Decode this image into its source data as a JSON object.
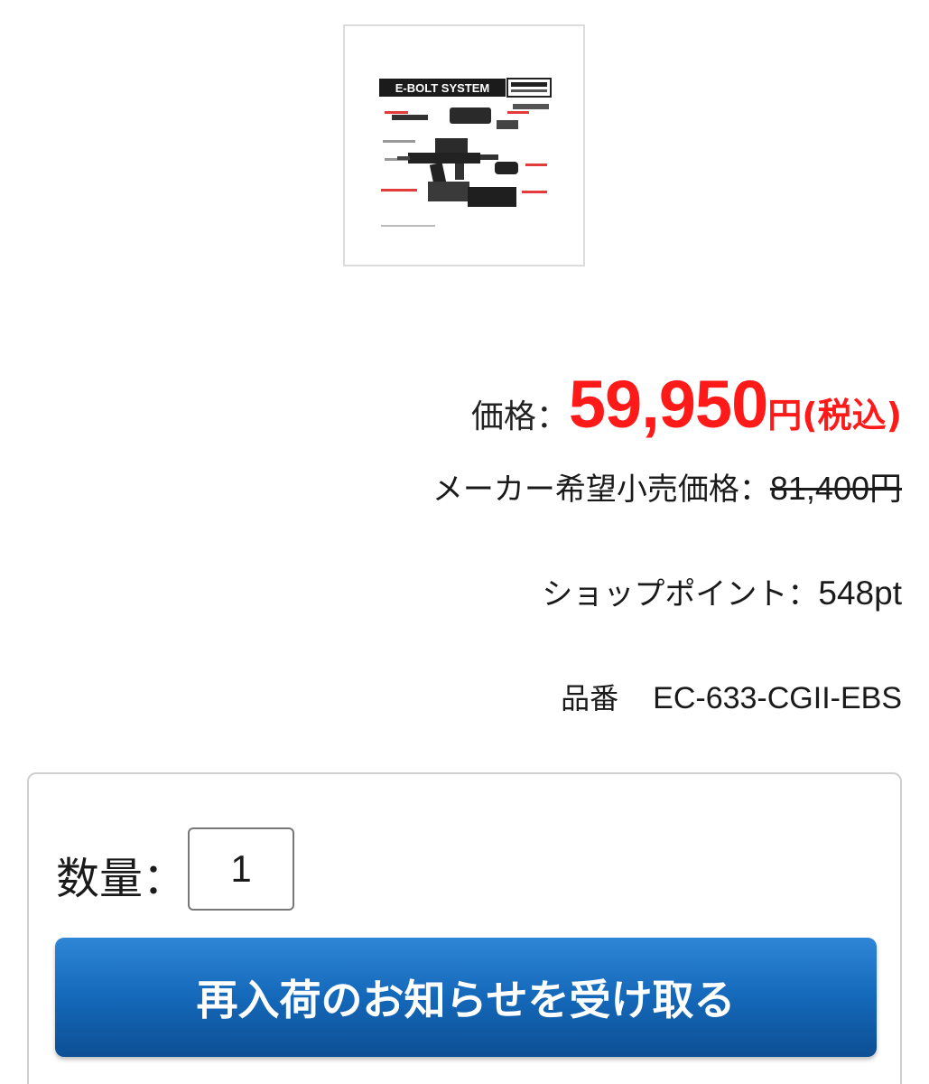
{
  "product_image": {
    "banner_text": "E-BOLT SYSTEM",
    "alt": "product thumbnail"
  },
  "price": {
    "label": "価格：",
    "amount": "59,950",
    "suffix": "円(税込)",
    "color": "#ff1a1a"
  },
  "msrp": {
    "label": "メーカー希望小売価格：",
    "amount": "81,400円"
  },
  "points": {
    "label": "ショップポイント：",
    "value": "548pt"
  },
  "product_code": {
    "label": "品番",
    "value": "EC-633-CGII-EBS"
  },
  "cart": {
    "quantity_label": "数量：",
    "quantity_value": "1",
    "restock_button_label": "再入荷のお知らせを受け取る",
    "button_color": "#1468b9"
  }
}
